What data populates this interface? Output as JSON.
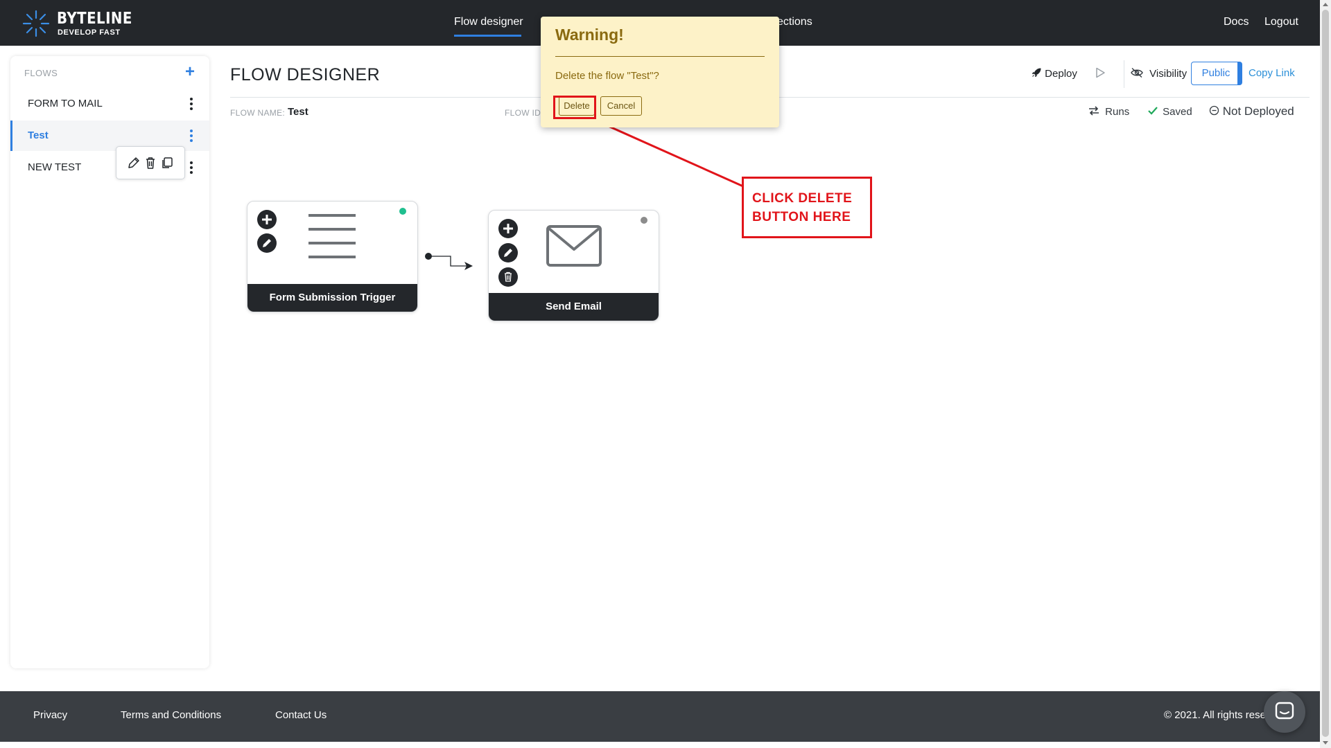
{
  "nav": {
    "brand": "BYTELINE",
    "tagline": "DEVELOP FAST",
    "flow_designer": "Flow designer",
    "connections": "ections",
    "docs": "Docs",
    "logout": "Logout"
  },
  "sidebar": {
    "heading": "FLOWS",
    "items": [
      {
        "label": "FORM TO MAIL"
      },
      {
        "label": "Test"
      },
      {
        "label": "NEW TEST"
      }
    ]
  },
  "header": {
    "title": "FLOW DESIGNER",
    "deploy": "Deploy",
    "visibility": "Visibility",
    "public": "Public",
    "copy_link": "Copy Link",
    "flow_name_label": "FLOW NAME:",
    "flow_name_value": "Test",
    "flow_id_label": "FLOW ID:",
    "runs": "Runs",
    "saved": "Saved",
    "not_deployed": "Not Deployed"
  },
  "nodes": [
    {
      "title": "Form Submission Trigger",
      "status_color": "#1fbf8f",
      "icon": "form-lines-icon"
    },
    {
      "title": "Send Email",
      "status_color": "#8c8c8c",
      "icon": "envelope-icon"
    }
  ],
  "warning": {
    "title": "Warning!",
    "message": "Delete the flow \"Test\"?",
    "delete": "Delete",
    "cancel": "Cancel"
  },
  "annotation": {
    "line1": "CLICK DELETE",
    "line2": "BUTTON HERE"
  },
  "footer": {
    "privacy": "Privacy",
    "terms": "Terms and Conditions",
    "contact": "Contact Us",
    "copyright": "© 2021. All rights reser"
  },
  "colors": {
    "nav_bg": "#24272b",
    "accent": "#2f7fe0",
    "warning_bg": "#fdf2c8",
    "warning_text": "#8a6a10",
    "annotation_red": "#e1141a",
    "footer_bg": "#3a3e43"
  }
}
